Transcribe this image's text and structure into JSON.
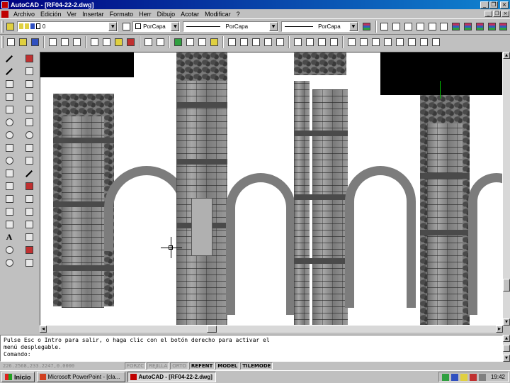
{
  "window": {
    "title": "AutoCAD - [RF04-22-2.dwg]",
    "minimize_glyph": "_",
    "restore_glyph": "❐",
    "close_glyph": "×"
  },
  "menu": {
    "items": [
      "Archivo",
      "Edición",
      "Ver",
      "Insertar",
      "Formato",
      "Herr",
      "Dibujo",
      "Acotar",
      "Modificar",
      "?"
    ]
  },
  "toolbar": {
    "layer_value": "0",
    "color_value": "PorCapa",
    "linetype_value": "PorCapa",
    "lineweight_value": "PorCapa"
  },
  "command": {
    "lines": [
      "Pulse Esc o Intro para salir, o haga clic con el botón derecho para activar el",
      "menú desplegable.",
      "Comando:"
    ]
  },
  "status": {
    "coords": "226.2568,233.2247,0.0000",
    "toggles": [
      {
        "label": "FORZC",
        "on": false
      },
      {
        "label": "REJILLA",
        "on": false
      },
      {
        "label": "ORTO",
        "on": false
      },
      {
        "label": "REFENT",
        "on": true
      },
      {
        "label": "MODEL",
        "on": true
      },
      {
        "label": "TILEMODE",
        "on": true
      }
    ]
  },
  "taskbar": {
    "start_label": "Inicio",
    "tasks": [
      {
        "label": "Microsoft PowerPoint - [cla...",
        "active": false
      },
      {
        "label": "AutoCAD - [RF04-22-2.dwg]",
        "active": true
      }
    ],
    "clock": "19:42"
  },
  "colors": {
    "title_start": "#000080",
    "title_end": "#1084d0",
    "ucs_green": "#00c000",
    "chrome": "#c0c0c0"
  }
}
